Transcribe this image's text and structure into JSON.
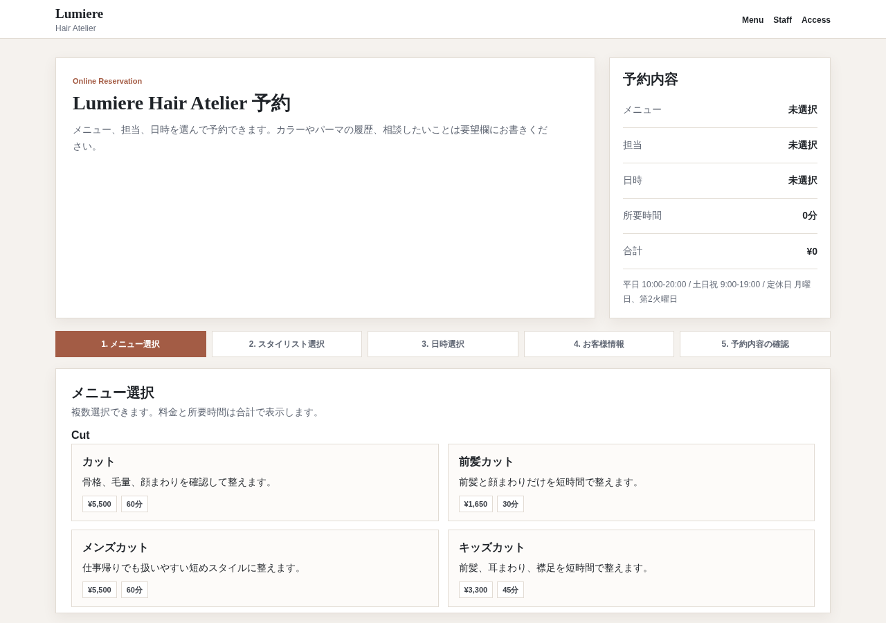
{
  "header": {
    "brand": "Lumiere",
    "tagline": "Hair Atelier",
    "nav": [
      "Menu",
      "Staff",
      "Access"
    ]
  },
  "hero": {
    "eyebrow": "Online Reservation",
    "title": "Lumiere Hair Atelier 予約",
    "description": "メニュー、担当、日時を選んで予約できます。カラーやパーマの履歴、相談したいことは要望欄にお書きください。"
  },
  "summary": {
    "title": "予約内容",
    "rows": [
      {
        "label": "メニュー",
        "value": "未選択"
      },
      {
        "label": "担当",
        "value": "未選択"
      },
      {
        "label": "日時",
        "value": "未選択"
      },
      {
        "label": "所要時間",
        "value": "0分"
      },
      {
        "label": "合計",
        "value": "¥0"
      }
    ],
    "note": "平日 10:00-20:00 / 土日祝 9:00-19:00 / 定休日 月曜日、第2火曜日"
  },
  "steps": [
    {
      "label": "1. メニュー選択",
      "selected": true
    },
    {
      "label": "2. スタイリスト選択",
      "selected": false
    },
    {
      "label": "3. 日時選択",
      "selected": false
    },
    {
      "label": "4. お客様情報",
      "selected": false
    },
    {
      "label": "5. 予約内容の確認",
      "selected": false
    }
  ],
  "menu_section": {
    "title": "メニュー選択",
    "subtitle": "複数選択できます。料金と所要時間は合計で表示します。",
    "categories": [
      {
        "name": "Cut",
        "items": [
          {
            "name": "カット",
            "description": "骨格、毛量、顔まわりを確認して整えます。",
            "price": "¥5,500",
            "duration": "60分"
          },
          {
            "name": "前髪カット",
            "description": "前髪と顔まわりだけを短時間で整えます。",
            "price": "¥1,650",
            "duration": "30分"
          },
          {
            "name": "メンズカット",
            "description": "仕事帰りでも扱いやすい短めスタイルに整えます。",
            "price": "¥5,500",
            "duration": "60分"
          },
          {
            "name": "キッズカット",
            "description": "前髪、耳まわり、襟足を短時間で整えます。",
            "price": "¥3,300",
            "duration": "45分"
          }
        ]
      }
    ]
  }
}
